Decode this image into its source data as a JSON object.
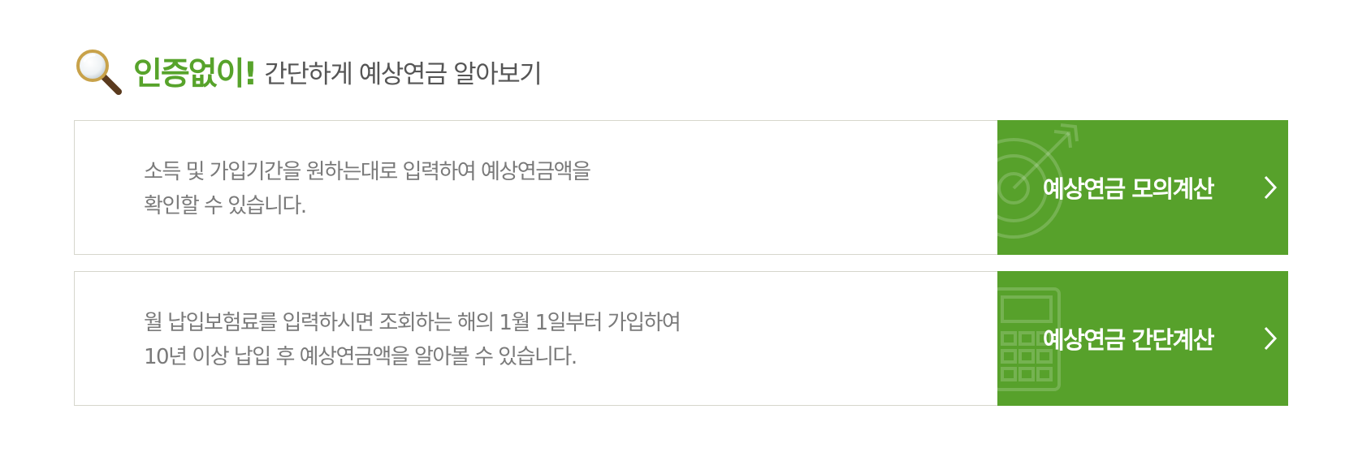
{
  "header": {
    "title_strong": "인증없이!",
    "title_rest": "간단하게 예상연금 알아보기",
    "icon": "magnifier-icon"
  },
  "cards": [
    {
      "description_lines": [
        "소득 및 가입기간을 원하는대로 입력하여 예상연금액을",
        "확인할 수 있습니다."
      ],
      "button_label": "예상연금 모의계산",
      "button_icon": "target-icon"
    },
    {
      "description_lines": [
        "월 납입보험료를 입력하시면 조회하는 해의 1월 1일부터 가입하여",
        "10년 이상 납입 후 예상연금액을 알아볼 수 있습니다."
      ],
      "button_label": "예상연금 간단계산",
      "button_icon": "calculator-icon"
    }
  ],
  "colors": {
    "accent": "#57a12b",
    "text_gray": "#7a7a7a",
    "title_gray": "#555555",
    "border": "#d6d6cc"
  }
}
